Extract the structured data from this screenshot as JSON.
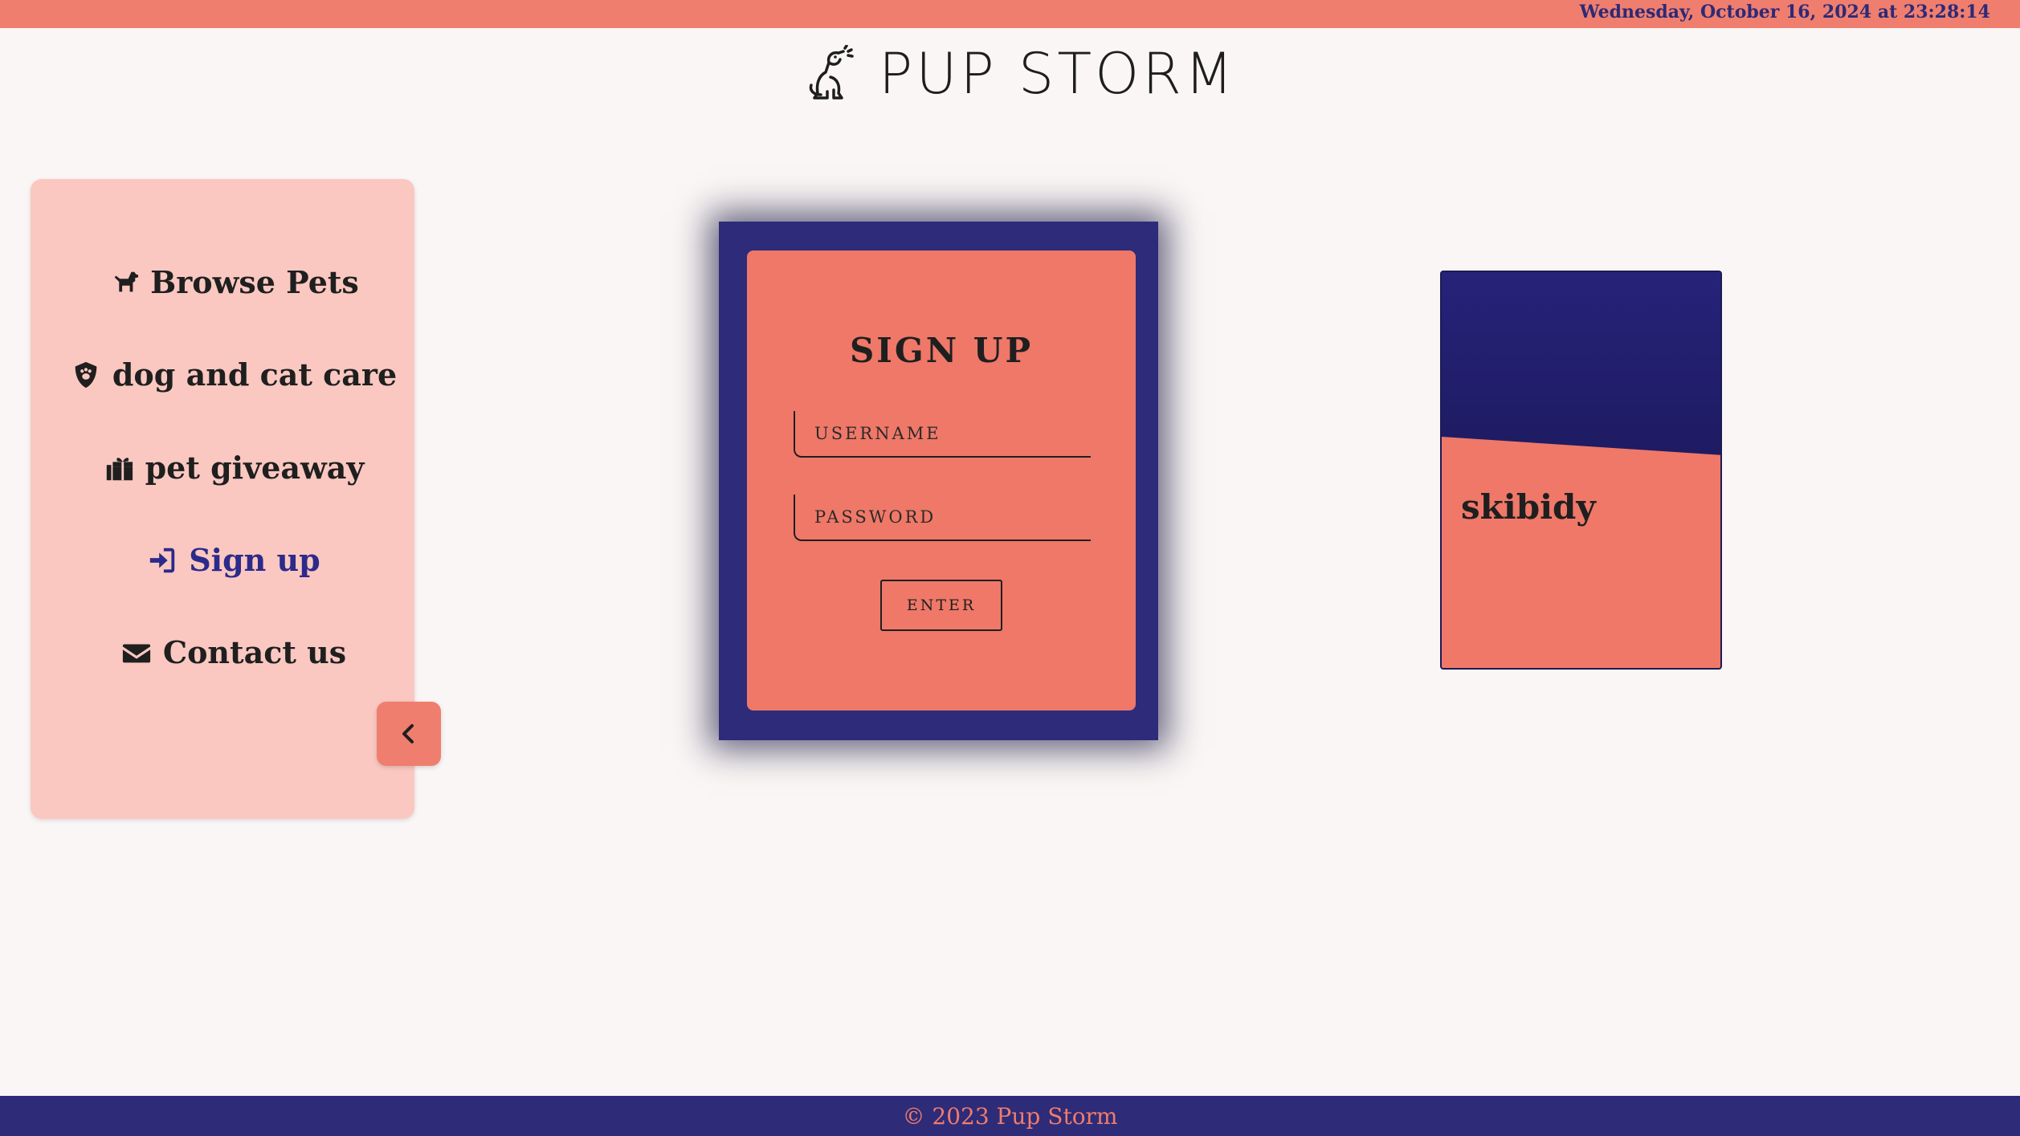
{
  "topbar": {
    "datetime": "Wednesday, October 16, 2024 at 23:28:14"
  },
  "header": {
    "brand": "PUP STORM",
    "logo_icon": "dog-sitting-icon"
  },
  "sidebar": {
    "items": [
      {
        "label": "Browse Pets",
        "icon": "dog-icon",
        "active": false
      },
      {
        "label": "dog and cat care",
        "icon": "shield-paw-icon",
        "active": false
      },
      {
        "label": "pet giveaway",
        "icon": "gift-hand-icon",
        "active": false
      },
      {
        "label": "Sign up",
        "icon": "sign-in-icon",
        "active": true
      },
      {
        "label": "Contact us",
        "icon": "envelope-icon",
        "active": false
      }
    ],
    "collapse_icon": "chevron-left-icon"
  },
  "signup": {
    "title": "SIGN UP",
    "username_placeholder": "USERNAME",
    "username_value": "",
    "password_placeholder": "PASSWORD",
    "password_value": "",
    "enter_label": "ENTER"
  },
  "promo": {
    "text": "skibidy"
  },
  "footer": {
    "copyright": "© 2023 Pup Storm"
  },
  "colors": {
    "coral": "#f07e6e",
    "navy": "#2d2b7a",
    "sidebar_bg": "#fac8c1",
    "page_bg": "#faf6f5"
  }
}
